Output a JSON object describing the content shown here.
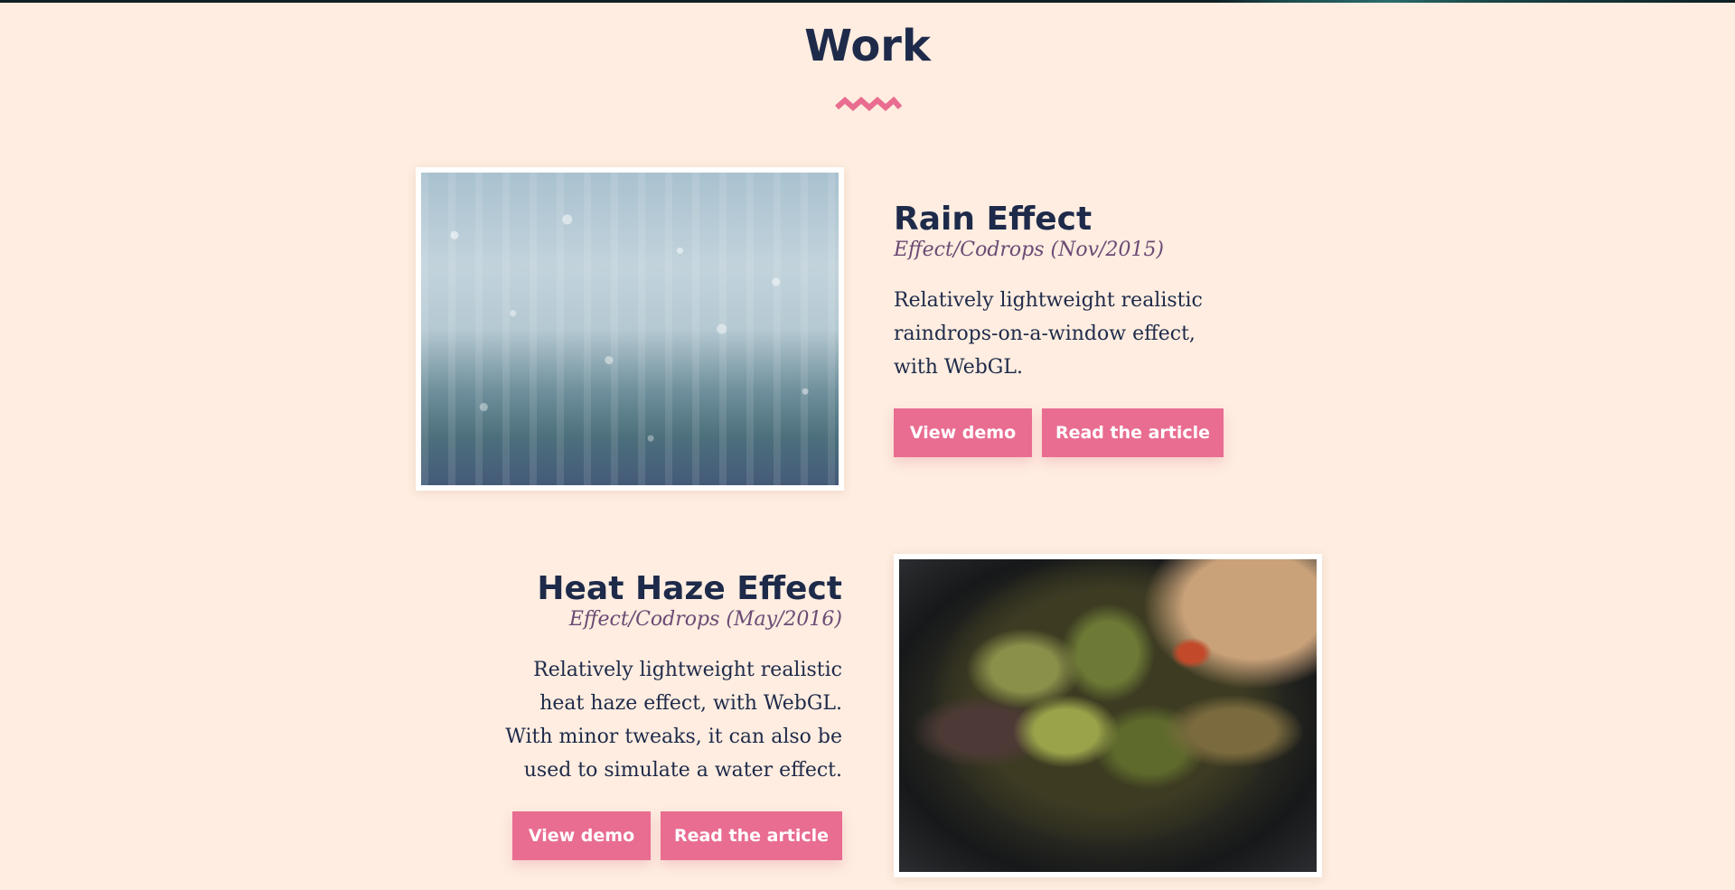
{
  "section": {
    "title": "Work"
  },
  "colors": {
    "background": "#feede0",
    "heading": "#1e2a4a",
    "meta": "#6b4a75",
    "button": "#e96d91",
    "zigzag": "#e96d91"
  },
  "projects": [
    {
      "title": "Rain Effect",
      "meta": "Effect/Codrops (Nov/2015)",
      "description": "Relatively lightweight realistic raindrops-on-a-window effect, with WebGL.",
      "demo_label": "View demo",
      "article_label": "Read the article",
      "image": "rain-window-photo"
    },
    {
      "title": "Heat Haze Effect",
      "meta": "Effect/Codrops (May/2016)",
      "description": "Relatively lightweight realistic heat haze effect, with WebGL. With minor tweaks, it can also be used to simulate a water effect.",
      "demo_label": "View demo",
      "article_label": "Read the article",
      "image": "artichoke-pan-photo"
    }
  ]
}
